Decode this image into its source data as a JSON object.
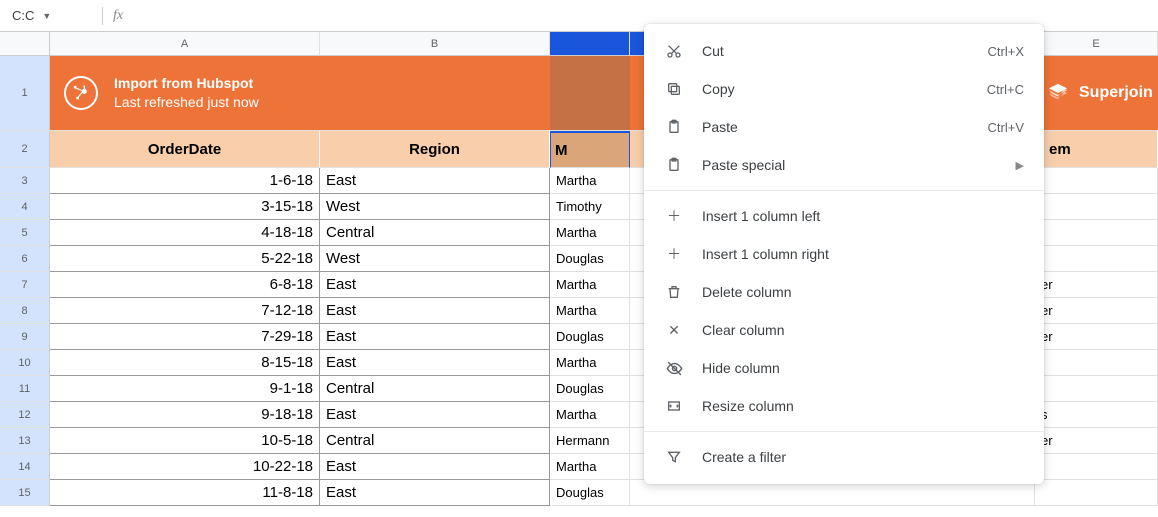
{
  "name_box": "C:C",
  "columns": {
    "A": "A",
    "B": "B",
    "C": "",
    "D": "",
    "E": "E"
  },
  "banner": {
    "title": "Import from Hubspot",
    "subtitle": "Last refreshed just now",
    "superjoin": "Superjoin"
  },
  "headers": {
    "A": "OrderDate",
    "B": "Region",
    "C": "M",
    "E": "em"
  },
  "rows": [
    {
      "n": "3",
      "A": "1-6-18",
      "B": "East",
      "C": "Martha",
      "E": ""
    },
    {
      "n": "4",
      "A": "3-15-18",
      "B": "West",
      "C": "Timothy",
      "E": ""
    },
    {
      "n": "5",
      "A": "4-18-18",
      "B": "Central",
      "C": "Martha",
      "E": ""
    },
    {
      "n": "6",
      "A": "5-22-18",
      "B": "West",
      "C": "Douglas",
      "E": ""
    },
    {
      "n": "7",
      "A": "6-8-18",
      "B": "East",
      "C": "Martha",
      "E": "er"
    },
    {
      "n": "8",
      "A": "7-12-18",
      "B": "East",
      "C": "Martha",
      "E": "er"
    },
    {
      "n": "9",
      "A": "7-29-18",
      "B": "East",
      "C": "Douglas",
      "E": "er"
    },
    {
      "n": "10",
      "A": "8-15-18",
      "B": "East",
      "C": "Martha",
      "E": ""
    },
    {
      "n": "11",
      "A": "9-1-18",
      "B": "Central",
      "C": "Douglas",
      "E": ""
    },
    {
      "n": "12",
      "A": "9-18-18",
      "B": "East",
      "C": "Martha",
      "E": "s"
    },
    {
      "n": "13",
      "A": "10-5-18",
      "B": "Central",
      "C": "Hermann",
      "E": "er"
    },
    {
      "n": "14",
      "A": "10-22-18",
      "B": "East",
      "C": "Martha",
      "E": ""
    },
    {
      "n": "15",
      "A": "11-8-18",
      "B": "East",
      "C": "Douglas",
      "E": ""
    }
  ],
  "row_labels": {
    "r1": "1",
    "r2": "2"
  },
  "menu": {
    "cut": "Cut",
    "cut_sc": "Ctrl+X",
    "copy": "Copy",
    "copy_sc": "Ctrl+C",
    "paste": "Paste",
    "paste_sc": "Ctrl+V",
    "paste_special": "Paste special",
    "insert_left": "Insert 1 column left",
    "insert_right": "Insert 1 column right",
    "delete_col": "Delete column",
    "clear_col": "Clear column",
    "hide_col": "Hide column",
    "resize_col": "Resize column",
    "create_filter": "Create a filter"
  }
}
